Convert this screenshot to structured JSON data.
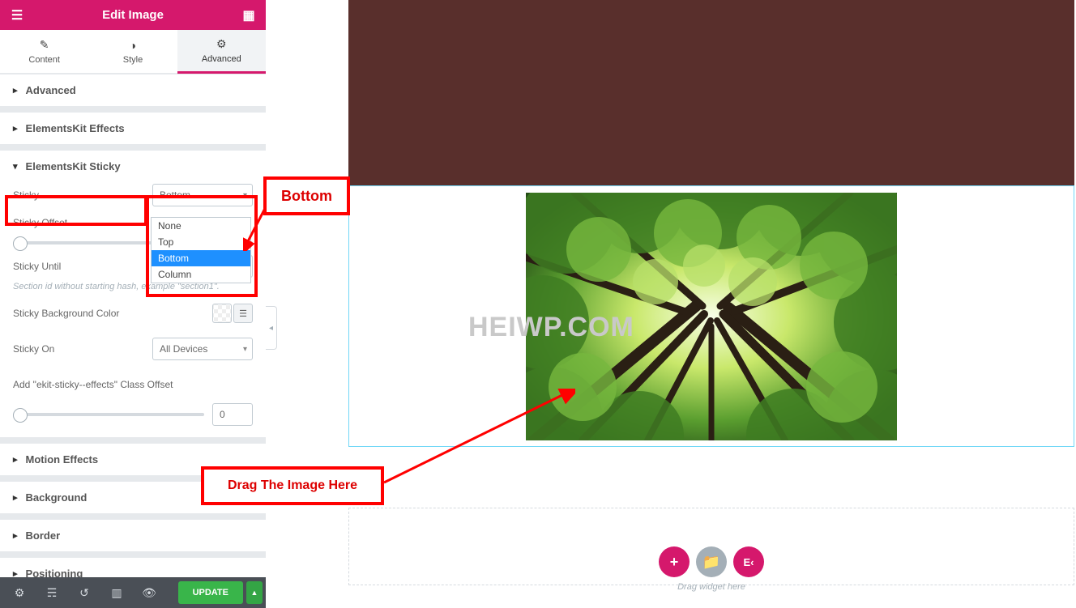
{
  "header": {
    "title": "Edit Image"
  },
  "tabs": {
    "content": "Content",
    "style": "Style",
    "advanced": "Advanced"
  },
  "sections": {
    "advanced": "Advanced",
    "ekit_effects": "ElementsKit Effects",
    "ekit_sticky": "ElementsKit Sticky",
    "motion": "Motion Effects",
    "background": "Background",
    "border": "Border",
    "positioning": "Positioning"
  },
  "sticky": {
    "label": "Sticky",
    "value": "Bottom",
    "options": {
      "none": "None",
      "top": "Top",
      "bottom": "Bottom",
      "column": "Column"
    },
    "offset_label": "Sticky Offset",
    "until_label": "Sticky Until",
    "until_hint": "Section id without starting hash, example \"section1\".",
    "bg_label": "Sticky Background Color",
    "on_label": "Sticky On",
    "on_value": "All Devices",
    "class_offset_label": "Add \"ekit-sticky--effects\" Class Offset",
    "class_offset_value": "0"
  },
  "footer": {
    "update": "UPDATE"
  },
  "canvas": {
    "watermark": "HEIWP.COM",
    "drag_hint": "Drag widget here"
  },
  "annotations": {
    "bottom": "Bottom",
    "drag": "Drag The Image Here"
  }
}
